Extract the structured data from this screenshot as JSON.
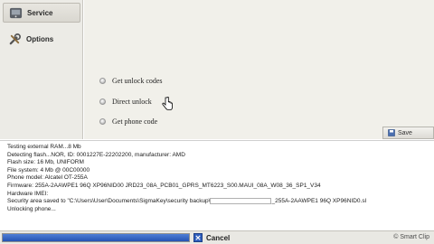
{
  "sidebar": {
    "items": [
      {
        "label": "Service",
        "icon": "service-icon"
      },
      {
        "label": "Options",
        "icon": "tools-icon"
      }
    ]
  },
  "main": {
    "actions": [
      {
        "label": "Get unlock codes"
      },
      {
        "label": "Direct unlock"
      },
      {
        "label": "Get phone code"
      }
    ],
    "save_label": "Save"
  },
  "log": {
    "lines": [
      "Testing external RAM...8 Mb",
      "Detecting flash...NOR, ID: 0001227E-22202200, manufacturer: AMD",
      "Flash size: 16 Mb, UNIFORM",
      "File system: 4 Mb @ 00C00000",
      "Phone model: Alcatel OT-255A",
      "Firmware: 255A-2AAWPE1 96Q XP96NID00 JRD23_08A_PCB01_GPRS_MT6223_S00.MAUI_08A_W08_36_SP1_V34",
      "Hardware IMEI:",
      "Unlocking phone..."
    ],
    "security_prefix": "Security area saved to \"C:\\Users\\User\\Documents\\SigmaKey\\security backup\\",
    "security_suffix": "_255A-2AAWPE1 96Q XP96NID0.sl"
  },
  "status": {
    "progress_fraction": 1.0,
    "cancel_label": "Cancel",
    "watermark": "© Smart Clip"
  },
  "colors": {
    "progress": "#2553b3",
    "cancel": "#2f5fbf"
  }
}
